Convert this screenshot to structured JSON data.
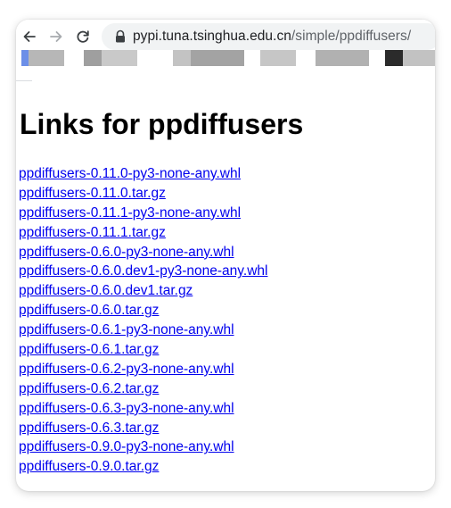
{
  "browser": {
    "url_host": "pypi.tuna.tsinghua.edu.cn",
    "url_path": "/simple/ppdiffusers/",
    "icons": {
      "back": "back-arrow-icon",
      "forward": "forward-arrow-icon",
      "reload": "reload-icon",
      "lock": "lock-icon"
    },
    "colors": {
      "omnibox_bg": "#f1f3f4",
      "link": "#0000ee"
    }
  },
  "page": {
    "heading": "Links for ppdiffusers",
    "links": [
      "ppdiffusers-0.11.0-py3-none-any.whl",
      "ppdiffusers-0.11.0.tar.gz",
      "ppdiffusers-0.11.1-py3-none-any.whl",
      "ppdiffusers-0.11.1.tar.gz",
      "ppdiffusers-0.6.0-py3-none-any.whl",
      "ppdiffusers-0.6.0.dev1-py3-none-any.whl",
      "ppdiffusers-0.6.0.dev1.tar.gz",
      "ppdiffusers-0.6.0.tar.gz",
      "ppdiffusers-0.6.1-py3-none-any.whl",
      "ppdiffusers-0.6.1.tar.gz",
      "ppdiffusers-0.6.2-py3-none-any.whl",
      "ppdiffusers-0.6.2.tar.gz",
      "ppdiffusers-0.6.3-py3-none-any.whl",
      "ppdiffusers-0.6.3.tar.gz",
      "ppdiffusers-0.9.0-py3-none-any.whl",
      "ppdiffusers-0.9.0.tar.gz"
    ]
  }
}
